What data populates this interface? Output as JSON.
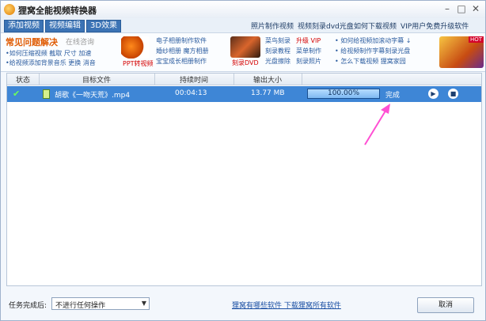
{
  "window": {
    "title": "狸窝全能视频转换器"
  },
  "tabs": [
    "添加视频",
    "视频编辑",
    "3D效果"
  ],
  "top_links": [
    "照片制作视频",
    "视频刻录dvd光盘",
    "如何下载视频",
    "VIP用户免费升级软件"
  ],
  "banner": {
    "title": "常见问题解决",
    "subtitle": "在线咨询",
    "lines_left": [
      "•如何压缩视频 截取 尺寸 加速",
      "•给视频添加背景音乐 更换 消音"
    ],
    "ppt_label": "PPT转视频",
    "col2": [
      "电子相册制作软件",
      "婚纱相册 魔方相册",
      "宝宝成长相册制作"
    ],
    "record_label": "刻录DVD",
    "col3_a": [
      "菜鸟刻录",
      "刻录教程",
      "光盘擦除"
    ],
    "col3_b": [
      "升级 VIP",
      "菜单制作",
      "刻录照片"
    ],
    "col4": [
      "• 如何给视频加滚动字幕 ↓",
      "• 给视频制作字幕刻录光盘",
      "• 怎么下载视频 狸窝家园"
    ],
    "hot_tag": "HOT"
  },
  "columns": [
    "状态",
    "目标文件",
    "持续时间",
    "输出大小"
  ],
  "row": {
    "status": "✔",
    "file": "胡歌《一吻天荒》.mp4",
    "duration": "00:04:13",
    "size": "13.77 MB",
    "progress_text": "100.00%",
    "progress_fraction": 1.0,
    "state": "完成"
  },
  "bottom": {
    "label": "任务完成后:",
    "select_value": "不进行任何操作",
    "link": "狸窝有哪些软件 下载狸窝所有软件",
    "cancel": "取消"
  },
  "colors": {
    "accent": "#3e86d6",
    "arrow": "#ff4fd3"
  }
}
